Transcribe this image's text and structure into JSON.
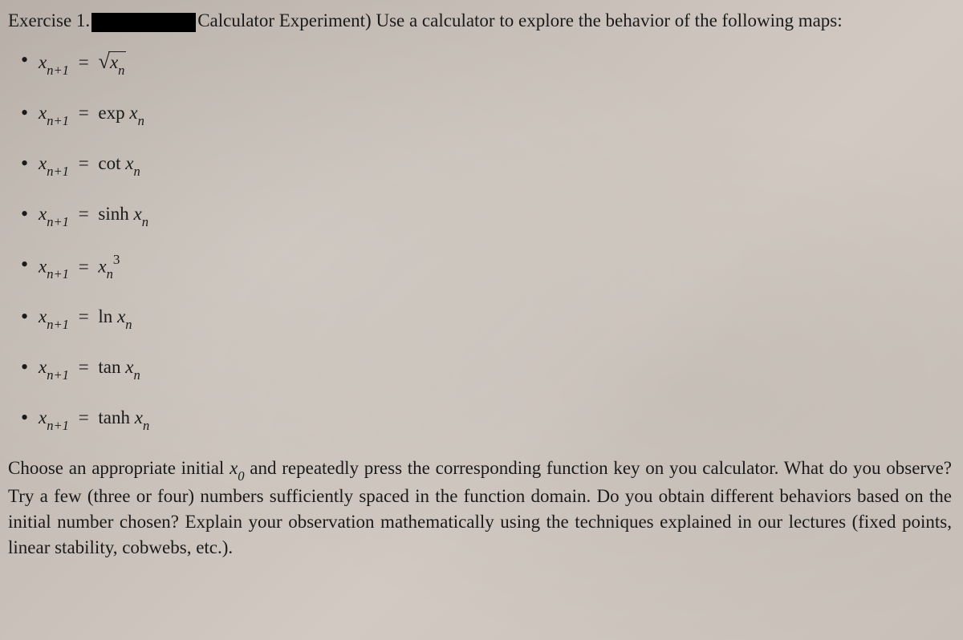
{
  "header": {
    "exercise": "Exercise 1.",
    "title_paren": "Calculator Experiment)",
    "intro": "Use a calculator to explore the behavior of the following maps:"
  },
  "items": [
    {
      "lhs_sub": "n+1",
      "rhs_type": "sqrt",
      "rhs_arg_sub": "n"
    },
    {
      "lhs_sub": "n+1",
      "rhs_type": "func",
      "func": "exp",
      "rhs_arg_sub": "n"
    },
    {
      "lhs_sub": "n+1",
      "rhs_type": "func",
      "func": "cot",
      "rhs_arg_sub": "n"
    },
    {
      "lhs_sub": "n+1",
      "rhs_type": "func",
      "func": "sinh",
      "rhs_arg_sub": "n"
    },
    {
      "lhs_sub": "n+1",
      "rhs_type": "power",
      "power": "3",
      "rhs_arg_sub": "n"
    },
    {
      "lhs_sub": "n+1",
      "rhs_type": "func",
      "func": "ln",
      "rhs_arg_sub": "n"
    },
    {
      "lhs_sub": "n+1",
      "rhs_type": "func",
      "func": "tan",
      "rhs_arg_sub": "n"
    },
    {
      "lhs_sub": "n+1",
      "rhs_type": "func",
      "func": "tanh",
      "rhs_arg_sub": "n"
    }
  ],
  "math": {
    "var": "x",
    "eq": "="
  },
  "footer": {
    "p1": "Choose an appropriate initial ",
    "x0_var": "x",
    "x0_sub": "0",
    "p2": " and repeatedly press the corresponding function key on you calculator.  What do you observe?  Try a few (three or four) numbers sufficiently spaced in the function domain.  Do you obtain different behaviors based on the initial number chosen?  Explain your observation mathematically using the techniques explained in our lectures (fixed points, linear stability, cobwebs, etc.)."
  }
}
